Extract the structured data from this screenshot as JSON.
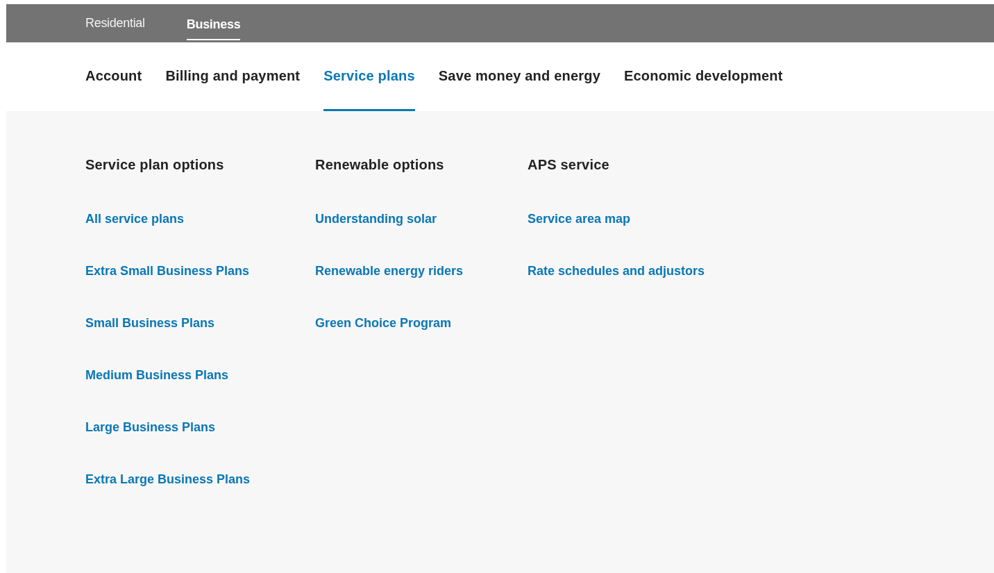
{
  "segments": [
    {
      "label": "Residential",
      "selected": false
    },
    {
      "label": "Business",
      "selected": true
    }
  ],
  "main_nav": [
    {
      "label": "Account",
      "selected": false
    },
    {
      "label": "Billing and payment",
      "selected": false
    },
    {
      "label": "Service plans",
      "selected": true
    },
    {
      "label": "Save money and energy",
      "selected": false
    },
    {
      "label": "Economic development",
      "selected": false
    }
  ],
  "mega_menu": {
    "columns": [
      {
        "heading": "Service plan options",
        "links": [
          "All service plans",
          "Extra Small Business Plans",
          "Small Business Plans",
          "Medium Business Plans",
          "Large Business Plans",
          "Extra Large Business Plans"
        ]
      },
      {
        "heading": "Renewable options",
        "links": [
          "Understanding solar",
          "Renewable energy riders",
          "Green Choice Program"
        ]
      },
      {
        "heading": "APS service",
        "links": [
          "Service area map",
          "Rate schedules and adjustors"
        ]
      }
    ]
  }
}
